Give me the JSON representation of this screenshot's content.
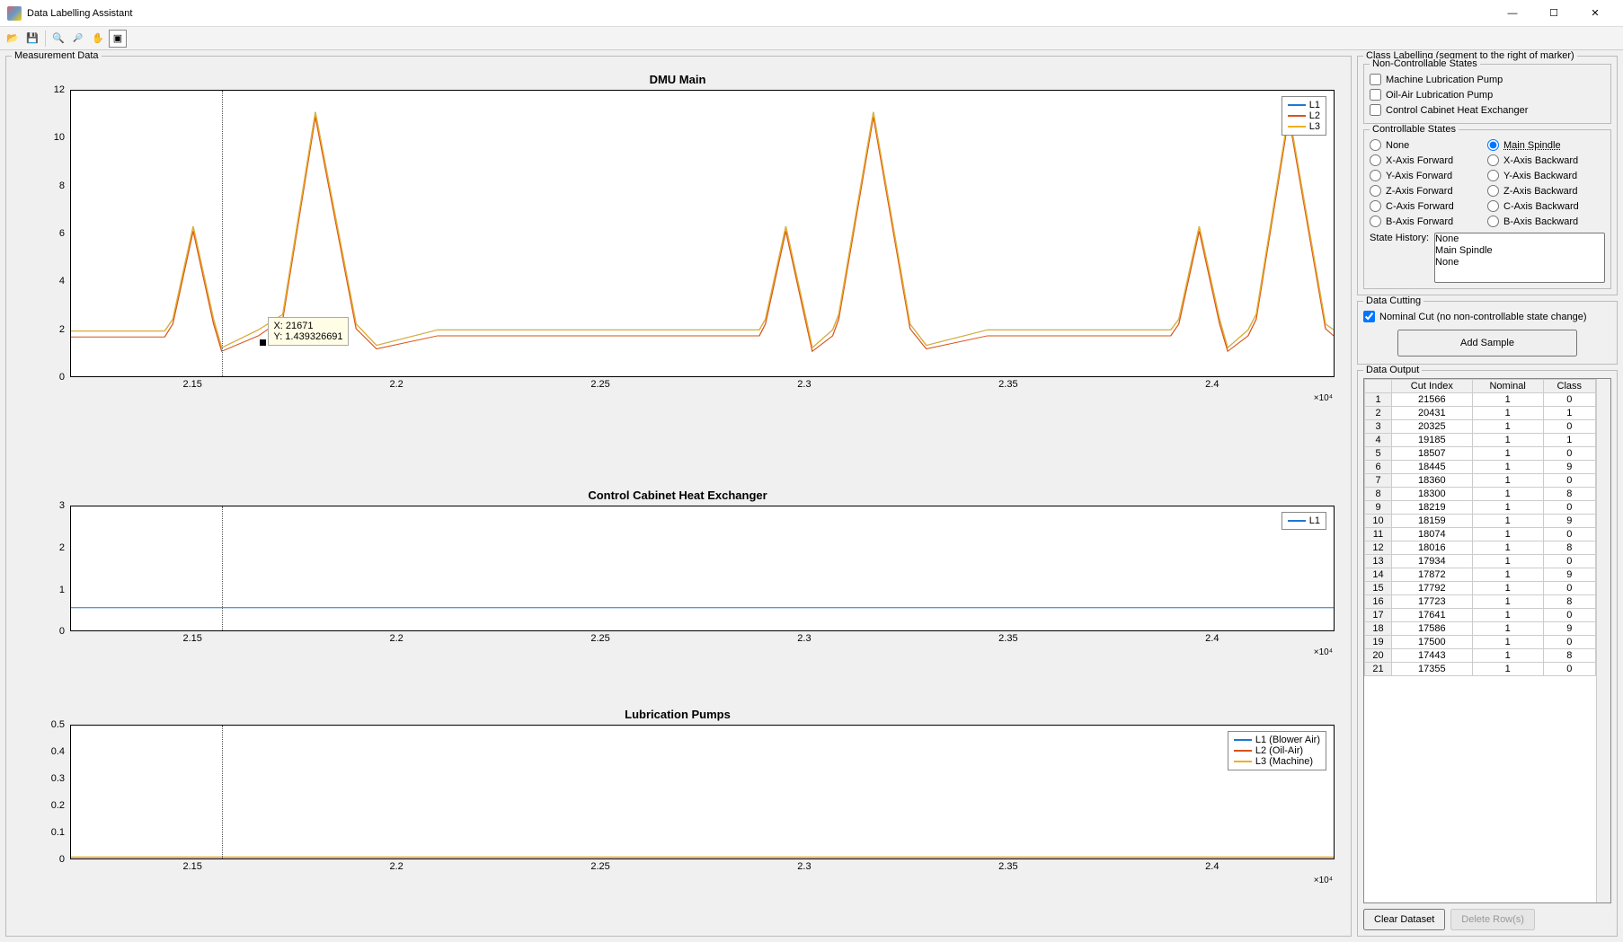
{
  "window": {
    "title": "Data Labelling Assistant"
  },
  "toolbar_icons": [
    "open",
    "save",
    "zoom-in",
    "zoom-out",
    "pan",
    "data-cursor"
  ],
  "left_panel": {
    "title": "Measurement Data"
  },
  "chart_data": [
    {
      "type": "line",
      "title": "DMU Main",
      "xlim": [
        21200,
        24300
      ],
      "ylim": [
        0,
        12
      ],
      "x_ticks": [
        21500,
        22000,
        22500,
        23000,
        23500,
        24000
      ],
      "x_tick_labels": [
        "2.15",
        "2.2",
        "2.25",
        "2.3",
        "2.35",
        "2.4"
      ],
      "x_exponent": "×10⁴",
      "y_ticks": [
        0,
        2,
        4,
        6,
        8,
        10,
        12
      ],
      "legend": [
        "L1",
        "L2",
        "L3"
      ],
      "marker_x": 21570,
      "datatip": {
        "x_label": "X: 21671",
        "y_label": "Y: 1.439326691",
        "at_x": 21671,
        "at_y": 1.44
      },
      "series": [
        {
          "name": "L1",
          "color": "#1f77d4",
          "pts": [
            [
              21200,
              1.9
            ],
            [
              21430,
              1.9
            ],
            [
              21450,
              2.4
            ],
            [
              21500,
              6.3
            ],
            [
              21550,
              2.4
            ],
            [
              21570,
              1.2
            ],
            [
              21660,
              1.95
            ],
            [
              21720,
              2.6
            ],
            [
              21800,
              11.1
            ],
            [
              21900,
              2.2
            ],
            [
              21950,
              1.3
            ],
            [
              22100,
              1.95
            ],
            [
              22890,
              1.95
            ],
            [
              22905,
              2.4
            ],
            [
              22955,
              6.3
            ],
            [
              23005,
              2.4
            ],
            [
              23020,
              1.2
            ],
            [
              23070,
              1.95
            ],
            [
              23085,
              2.6
            ],
            [
              23170,
              11.1
            ],
            [
              23260,
              2.2
            ],
            [
              23300,
              1.3
            ],
            [
              23450,
              1.95
            ],
            [
              23900,
              1.95
            ],
            [
              23920,
              2.4
            ],
            [
              23970,
              6.3
            ],
            [
              24020,
              2.4
            ],
            [
              24040,
              1.2
            ],
            [
              24090,
              1.95
            ],
            [
              24110,
              2.6
            ],
            [
              24190,
              11.1
            ],
            [
              24280,
              2.2
            ],
            [
              24300,
              1.95
            ]
          ]
        },
        {
          "name": "L2",
          "color": "#d95319",
          "pts": [
            [
              21200,
              1.65
            ],
            [
              21430,
              1.65
            ],
            [
              21450,
              2.2
            ],
            [
              21500,
              6.1
            ],
            [
              21550,
              2.2
            ],
            [
              21570,
              1.05
            ],
            [
              21660,
              1.7
            ],
            [
              21720,
              2.4
            ],
            [
              21800,
              10.9
            ],
            [
              21900,
              2.0
            ],
            [
              21950,
              1.15
            ],
            [
              22100,
              1.7
            ],
            [
              22890,
              1.7
            ],
            [
              22905,
              2.2
            ],
            [
              22955,
              6.1
            ],
            [
              23005,
              2.2
            ],
            [
              23020,
              1.05
            ],
            [
              23070,
              1.7
            ],
            [
              23085,
              2.4
            ],
            [
              23170,
              10.9
            ],
            [
              23260,
              2.0
            ],
            [
              23300,
              1.15
            ],
            [
              23450,
              1.7
            ],
            [
              23900,
              1.7
            ],
            [
              23920,
              2.2
            ],
            [
              23970,
              6.1
            ],
            [
              24020,
              2.2
            ],
            [
              24040,
              1.05
            ],
            [
              24090,
              1.7
            ],
            [
              24110,
              2.4
            ],
            [
              24190,
              10.9
            ],
            [
              24280,
              2.0
            ],
            [
              24300,
              1.7
            ]
          ]
        },
        {
          "name": "L3",
          "color": "#edb120",
          "pts": [
            [
              21200,
              1.9
            ],
            [
              21430,
              1.9
            ],
            [
              21450,
              2.4
            ],
            [
              21500,
              6.3
            ],
            [
              21550,
              2.4
            ],
            [
              21570,
              1.2
            ],
            [
              21660,
              1.95
            ],
            [
              21720,
              2.6
            ],
            [
              21800,
              11.1
            ],
            [
              21900,
              2.2
            ],
            [
              21950,
              1.3
            ],
            [
              22100,
              1.95
            ],
            [
              22890,
              1.95
            ],
            [
              22905,
              2.4
            ],
            [
              22955,
              6.3
            ],
            [
              23005,
              2.4
            ],
            [
              23020,
              1.2
            ],
            [
              23070,
              1.95
            ],
            [
              23085,
              2.6
            ],
            [
              23170,
              11.1
            ],
            [
              23260,
              2.2
            ],
            [
              23300,
              1.3
            ],
            [
              23450,
              1.95
            ],
            [
              23900,
              1.95
            ],
            [
              23920,
              2.4
            ],
            [
              23970,
              6.3
            ],
            [
              24020,
              2.4
            ],
            [
              24040,
              1.2
            ],
            [
              24090,
              1.95
            ],
            [
              24110,
              2.6
            ],
            [
              24190,
              11.1
            ],
            [
              24280,
              2.2
            ],
            [
              24300,
              1.95
            ]
          ]
        }
      ]
    },
    {
      "type": "line",
      "title": "Control Cabinet Heat Exchanger",
      "xlim": [
        21200,
        24300
      ],
      "ylim": [
        0,
        3
      ],
      "x_ticks": [
        21500,
        22000,
        22500,
        23000,
        23500,
        24000
      ],
      "x_tick_labels": [
        "2.15",
        "2.2",
        "2.25",
        "2.3",
        "2.35",
        "2.4"
      ],
      "x_exponent": "×10⁴",
      "y_ticks": [
        0,
        1,
        2,
        3
      ],
      "legend": [
        "L1"
      ],
      "marker_x": 21570,
      "series": [
        {
          "name": "L1",
          "color": "#1f77d4",
          "pts": [
            [
              21200,
              0.55
            ],
            [
              24300,
              0.55
            ]
          ]
        }
      ]
    },
    {
      "type": "line",
      "title": "Lubrication Pumps",
      "xlim": [
        21200,
        24300
      ],
      "ylim": [
        0,
        0.5
      ],
      "x_ticks": [
        21500,
        22000,
        22500,
        23000,
        23500,
        24000
      ],
      "x_tick_labels": [
        "2.15",
        "2.2",
        "2.25",
        "2.3",
        "2.35",
        "2.4"
      ],
      "x_exponent": "×10⁴",
      "y_ticks": [
        0,
        0.1,
        0.2,
        0.3,
        0.4,
        0.5
      ],
      "legend": [
        "L1 (Blower Air)",
        "L2 (Oil-Air)",
        "L3 (Machine)"
      ],
      "marker_x": 21570,
      "series": [
        {
          "name": "L1 (Blower Air)",
          "color": "#1f77d4",
          "pts": [
            [
              21200,
              0.005
            ],
            [
              24300,
              0.005
            ]
          ]
        },
        {
          "name": "L2 (Oil-Air)",
          "color": "#d95319",
          "pts": [
            [
              21200,
              0.004
            ],
            [
              24300,
              0.004
            ]
          ]
        },
        {
          "name": "L3 (Machine)",
          "color": "#edb120",
          "pts": [
            [
              21200,
              0.006
            ],
            [
              24300,
              0.006
            ]
          ]
        }
      ]
    }
  ],
  "class_labelling": {
    "title": "Class Labelling (segment to the right of marker)",
    "non_controllable": {
      "title": "Non-Controllable States",
      "items": [
        "Machine Lubrication Pump",
        "Oil-Air Lubrication Pump",
        "Control Cabinet Heat Exchanger"
      ]
    },
    "controllable": {
      "title": "Controllable States",
      "left": [
        "None",
        "X-Axis Forward",
        "Y-Axis Forward",
        "Z-Axis Forward",
        "C-Axis Forward",
        "B-Axis Forward"
      ],
      "right": [
        "Main Spindle",
        "X-Axis Backward",
        "Y-Axis Backward",
        "Z-Axis Backward",
        "C-Axis Backward",
        "B-Axis Backward"
      ],
      "selected": "Main Spindle"
    },
    "state_history": {
      "label": "State History:",
      "items": [
        "None",
        "Main Spindle",
        "None"
      ]
    }
  },
  "data_cutting": {
    "title": "Data Cutting",
    "nominal_cut_label": "Nominal Cut (no non-controllable state change)",
    "nominal_cut_checked": true,
    "add_sample_label": "Add Sample"
  },
  "data_output": {
    "title": "Data Output",
    "columns": [
      "Cut Index",
      "Nominal",
      "Class"
    ],
    "rows": [
      [
        1,
        21566,
        1,
        0
      ],
      [
        2,
        20431,
        1,
        1
      ],
      [
        3,
        20325,
        1,
        0
      ],
      [
        4,
        19185,
        1,
        1
      ],
      [
        5,
        18507,
        1,
        0
      ],
      [
        6,
        18445,
        1,
        9
      ],
      [
        7,
        18360,
        1,
        0
      ],
      [
        8,
        18300,
        1,
        8
      ],
      [
        9,
        18219,
        1,
        0
      ],
      [
        10,
        18159,
        1,
        9
      ],
      [
        11,
        18074,
        1,
        0
      ],
      [
        12,
        18016,
        1,
        8
      ],
      [
        13,
        17934,
        1,
        0
      ],
      [
        14,
        17872,
        1,
        9
      ],
      [
        15,
        17792,
        1,
        0
      ],
      [
        16,
        17723,
        1,
        8
      ],
      [
        17,
        17641,
        1,
        0
      ],
      [
        18,
        17586,
        1,
        9
      ],
      [
        19,
        17500,
        1,
        0
      ],
      [
        20,
        17443,
        1,
        8
      ],
      [
        21,
        17355,
        1,
        0
      ]
    ],
    "clear_label": "Clear Dataset",
    "delete_label": "Delete Row(s)"
  }
}
